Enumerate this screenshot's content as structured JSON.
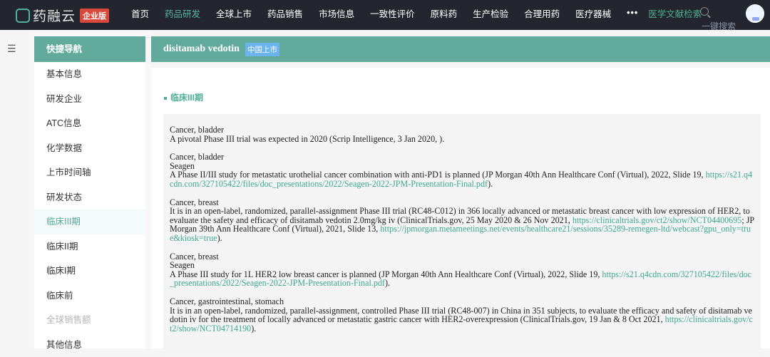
{
  "header": {
    "brand": "药融云",
    "edition": "企业版",
    "nav": [
      "首页",
      "药品研发",
      "全球上市",
      "药品销售",
      "市场信息",
      "一致性评价",
      "原料药",
      "生产检验",
      "合理用药",
      "医疗器械"
    ],
    "active_nav": "药品研发",
    "more": "•••",
    "literature": "医学文献检索",
    "search_label": "一键搜索"
  },
  "sidebar": {
    "title": "快捷导航",
    "items": [
      {
        "label": "基本信息"
      },
      {
        "label": "研发企业"
      },
      {
        "label": "ATC信息"
      },
      {
        "label": "化学数据"
      },
      {
        "label": "上市时间轴"
      },
      {
        "label": "研发状态"
      },
      {
        "label": "临床III期",
        "active": true
      },
      {
        "label": "临床II期"
      },
      {
        "label": "临床I期"
      },
      {
        "label": "临床前"
      },
      {
        "label": "全球销售额",
        "disabled": true
      },
      {
        "label": "其他信息"
      }
    ]
  },
  "drug": {
    "name": "disitamab vedotin",
    "badge": "中国上市"
  },
  "section": {
    "title": "临床III期"
  },
  "entries": [
    {
      "lines": [
        "Cancer, bladder"
      ],
      "segments": [
        {
          "t": "A pivotal Phase III trial was expected in 2020 (Scrip Intelligence, 3 Jan 2020, )."
        }
      ]
    },
    {
      "lines": [
        "Cancer, bladder",
        "Seagen"
      ],
      "segments": [
        {
          "t": "A Phase II/III study for metastatic urothelial cancer combination with anti-PD1 is planned (JP Morgan 40th Ann Healthcare Conf (Virtual), 2022, Slide 19, "
        },
        {
          "t": "https://s21.q4cdn.com/327105422/files/doc_presentations/2022/Seagen-2022-JPM-Presentation-Final.pdf",
          "link": true
        },
        {
          "t": ")."
        }
      ]
    },
    {
      "lines": [
        "Cancer, breast"
      ],
      "segments": [
        {
          "t": "It is in an open-label, randomized, parallel-assignment Phase III trial (RC48-C012) in 366 locally advanced or metastatic breast cancer with low expression of HER2, to evaluate the safety and efficacy of disitamab vedotin 2.0mg/kg iv (ClinicalTrials.gov, 25 May 2020 & 26 Nov 2021, "
        },
        {
          "t": "https://clinicaltrials.gov/ct2/show/NCT04400695",
          "link": true
        },
        {
          "t": "; JP Morgan 39th Ann Healthcare Conf (Virtual), 2021, Slide 13, "
        },
        {
          "t": "https://jpmorgan.metameetings.net/events/healthcare21/sessions/35289-remegen-ltd/webcast?gpu_only=true&kiosk=true",
          "link": true
        },
        {
          "t": ")."
        }
      ]
    },
    {
      "lines": [
        "Cancer, breast",
        "Seagen"
      ],
      "segments": [
        {
          "t": "A Phase III study for 1L HER2 low breast cancer is planned (JP Morgan 40th Ann Healthcare Conf (Virtual), 2022, Slide 19, "
        },
        {
          "t": "https://s21.q4cdn.com/327105422/files/doc_presentations/2022/Seagen-2022-JPM-Presentation-Final.pdf",
          "link": true
        },
        {
          "t": ")."
        }
      ]
    },
    {
      "lines": [
        "Cancer, gastrointestinal, stomach"
      ],
      "segments": [
        {
          "t": "It is in an open-label, randomized, parallel-assignment, controlled Phase III trial (RC48-007) in China in 351 subjects, to evaluate the efficacy and safety of disitamab vedotin iv for the treatment of locally advanced or metastatic gastric cancer with HER2-overexpression (ClinicalTrials.gov, 19 Jan & 8 Oct 2021, "
        },
        {
          "t": "https://clinicaltrials.gov/ct2/show/NCT04714190",
          "link": true
        },
        {
          "t": ")."
        }
      ]
    }
  ],
  "colors": {
    "topbar": "#23262f",
    "accent": "#62ab9c",
    "link": "#3ea88e",
    "badge": "#d9493b"
  }
}
